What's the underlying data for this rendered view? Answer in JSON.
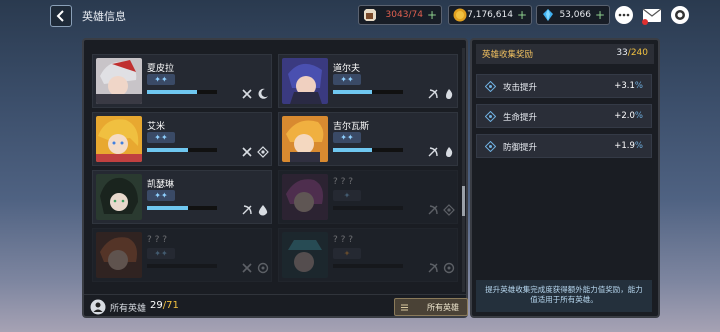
{
  "header": {
    "title": "英雄信息",
    "resources": [
      {
        "name": "stamina",
        "value": "3043/74",
        "color": "#e06050",
        "icon": "coffee-cup-icon"
      },
      {
        "name": "gold",
        "value": "7,176,614",
        "color": "#ffffff",
        "icon": "gold-coin-icon"
      },
      {
        "name": "gems",
        "value": "53,066",
        "color": "#ffffff",
        "icon": "diamond-icon"
      }
    ],
    "plus": "+"
  },
  "heroes": [
    {
      "name": "夏皮拉",
      "tag": "✦✦",
      "progress": 0.72,
      "icons": [
        "sword-cross-icon",
        "moon-icon"
      ]
    },
    {
      "name": "道尔夫",
      "tag": "✦✦",
      "progress": 0.55,
      "icons": [
        "bow-icon",
        "flame-icon"
      ]
    },
    {
      "name": "艾米",
      "tag": "✦✦",
      "progress": 0.58,
      "icons": [
        "sword-cross-icon",
        "diamond-element-icon"
      ]
    },
    {
      "name": "吉尔瓦斯",
      "tag": "✦✦",
      "progress": 0.55,
      "icons": [
        "bow-icon",
        "flame-icon"
      ]
    },
    {
      "name": "凯瑟琳",
      "tag": "✦✦",
      "progress": 0.58,
      "icons": [
        "bow-icon",
        "water-drop-icon"
      ]
    },
    {
      "name": "? ? ?",
      "tag": "✦",
      "progress": 0.0,
      "icons": [
        "bow-icon",
        "diamond-element-icon"
      ]
    },
    {
      "name": "? ? ?",
      "tag": "✦✦",
      "progress": 0.0,
      "icons": [
        "sword-cross-icon",
        "gear-element-icon"
      ]
    },
    {
      "name": "? ? ?",
      "tag": "✦",
      "progress": 0.0,
      "icons": [
        "bow-icon",
        "gear-element-icon"
      ]
    }
  ],
  "footer": {
    "label": "所有英雄",
    "owned": "29",
    "separator": "/",
    "total": "71",
    "filter_label": "所有英雄"
  },
  "collection": {
    "title": "英雄收集奖励",
    "count": "33",
    "count_sep": "/",
    "count_total": "240",
    "stats": [
      {
        "name": "攻击提升",
        "value": "+3.1",
        "unit": "%"
      },
      {
        "name": "生命提升",
        "value": "+2.0",
        "unit": "%"
      },
      {
        "name": "防御提升",
        "value": "+1.9",
        "unit": "%"
      }
    ],
    "description": "提升英雄收集完成度获得额外能力值奖励，能力值适用于所有英雄。"
  }
}
